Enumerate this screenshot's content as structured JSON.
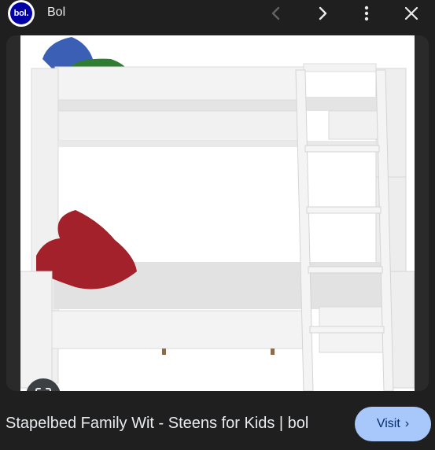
{
  "header": {
    "logo_text": "bol.",
    "site_name": "Bol"
  },
  "image": {
    "alt": "Stapelbed Family Wit - Steens for Kids | bol"
  },
  "footer": {
    "caption": "Stapelbed Family Wit - Steens for Kids | bol",
    "visit_label": "Visit",
    "visit_chevron": "›"
  },
  "icons": {
    "prev": "chevron-left-icon",
    "next": "chevron-right-icon",
    "more": "more-vert-icon",
    "close": "close-icon",
    "lens": "lens-icon"
  },
  "colors": {
    "background": "#1f1f1f",
    "visit_bg": "#a8c7fa",
    "visit_text": "#062e6f",
    "logo_blue": "#0000a4",
    "pillow_blue": "#3a5fb4",
    "pillow_green": "#2e7d32",
    "pillow_red": "#a3212a"
  }
}
